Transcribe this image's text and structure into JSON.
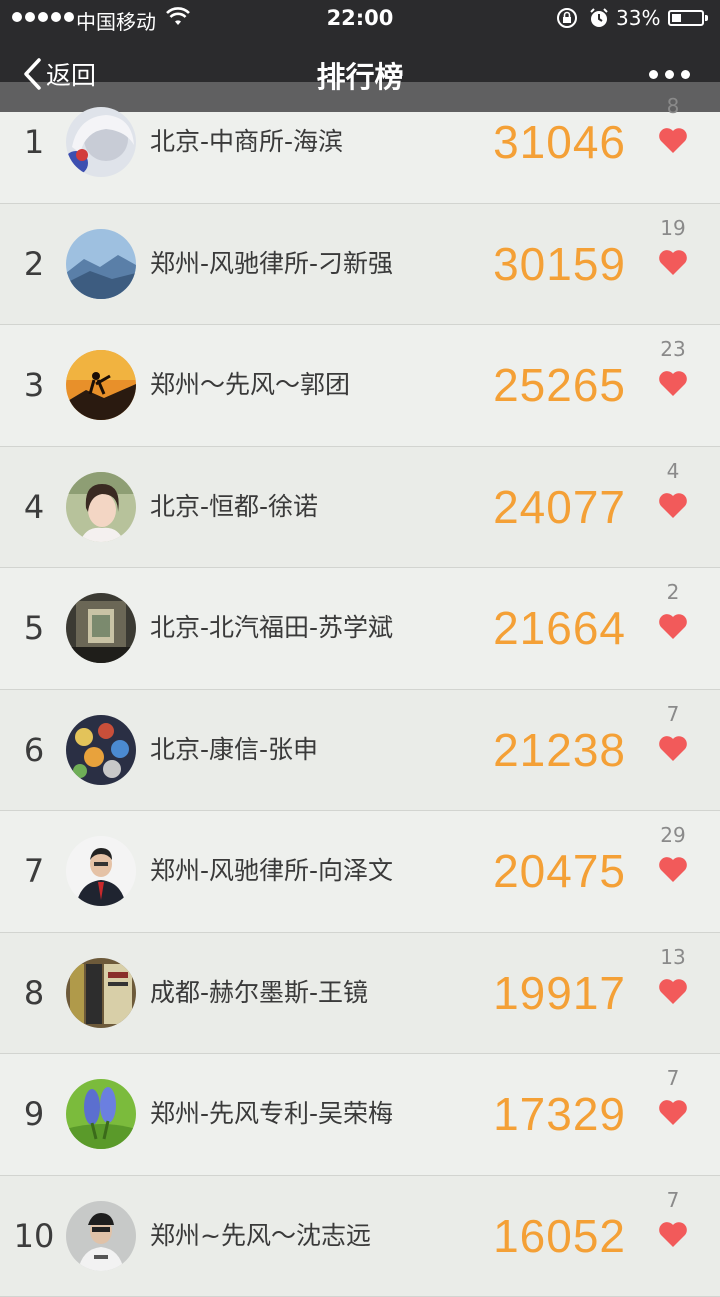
{
  "status_bar": {
    "carrier": "中国移动",
    "time": "22:00",
    "battery": "33%",
    "battery_level": 0.33
  },
  "nav": {
    "back_label": "返回",
    "title": "排行榜"
  },
  "accent_color": "#f4a036",
  "heart_color": "#f25a5a",
  "ranking": [
    {
      "rank": "1",
      "name": "北京-中商所-海滨",
      "score": "31046",
      "likes": "8"
    },
    {
      "rank": "2",
      "name": "郑州-风驰律所-刁新强",
      "score": "30159",
      "likes": "19"
    },
    {
      "rank": "3",
      "name": "郑州～先风～郭团",
      "score": "25265",
      "likes": "23"
    },
    {
      "rank": "4",
      "name": "北京-恒都-徐诺",
      "score": "24077",
      "likes": "4"
    },
    {
      "rank": "5",
      "name": "北京-北汽福田-苏学斌",
      "score": "21664",
      "likes": "2"
    },
    {
      "rank": "6",
      "name": "北京-康信-张申",
      "score": "21238",
      "likes": "7"
    },
    {
      "rank": "7",
      "name": "郑州-风驰律所-向泽文",
      "score": "20475",
      "likes": "29"
    },
    {
      "rank": "8",
      "name": "成都-赫尔墨斯-王镜",
      "score": "19917",
      "likes": "13"
    },
    {
      "rank": "9",
      "name": "郑州-先风专利-吴荣梅",
      "score": "17329",
      "likes": "7"
    },
    {
      "rank": "10",
      "name": "郑州~先风～沈志远",
      "score": "16052",
      "likes": "7"
    }
  ]
}
